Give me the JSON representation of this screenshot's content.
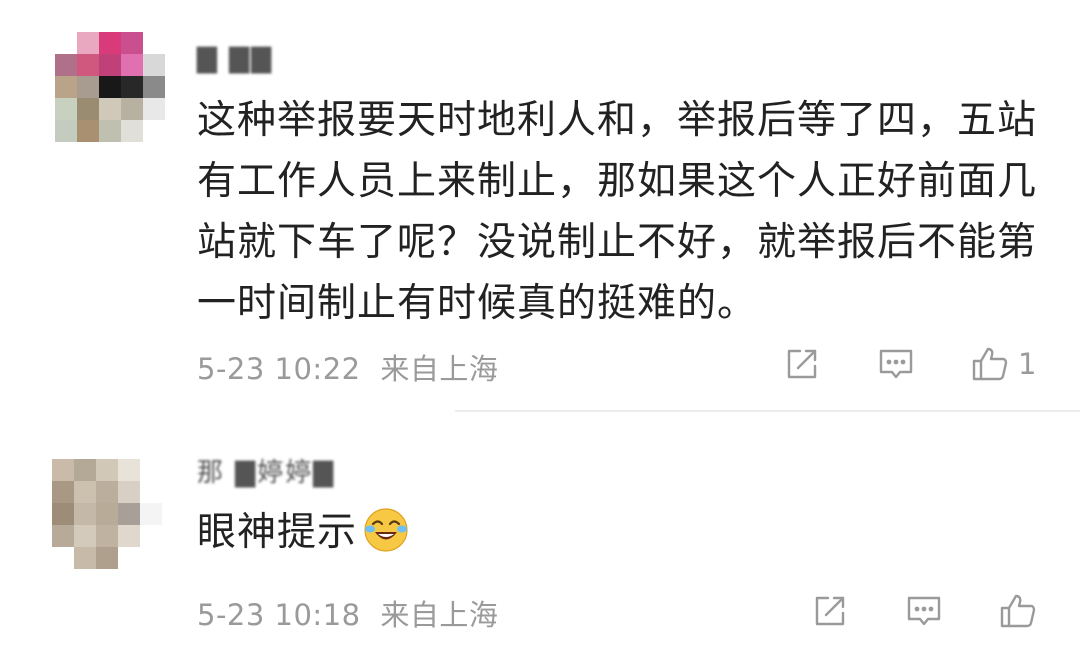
{
  "comments": [
    {
      "username": "▇ ▇▇",
      "text": "这种举报要天时地利人和，举报后等了四，五站有工作人员上来制止，那如果这个人正好前面几站就下车了呢？没说制止不好，就举报后不能第一时间制止有时候真的挺难的。",
      "date": "5-23 10:22",
      "location": "来自上海",
      "like_count": "1",
      "icons": [
        "share-icon",
        "comment-icon",
        "like-icon"
      ]
    },
    {
      "username": "那 ▇婷婷▇",
      "text": "眼神提示",
      "emoji": "crying-laughing-emoji",
      "date": "5-23 10:18",
      "location": "来自上海",
      "like_count": "",
      "icons": [
        "share-icon",
        "comment-icon",
        "like-icon"
      ]
    }
  ]
}
